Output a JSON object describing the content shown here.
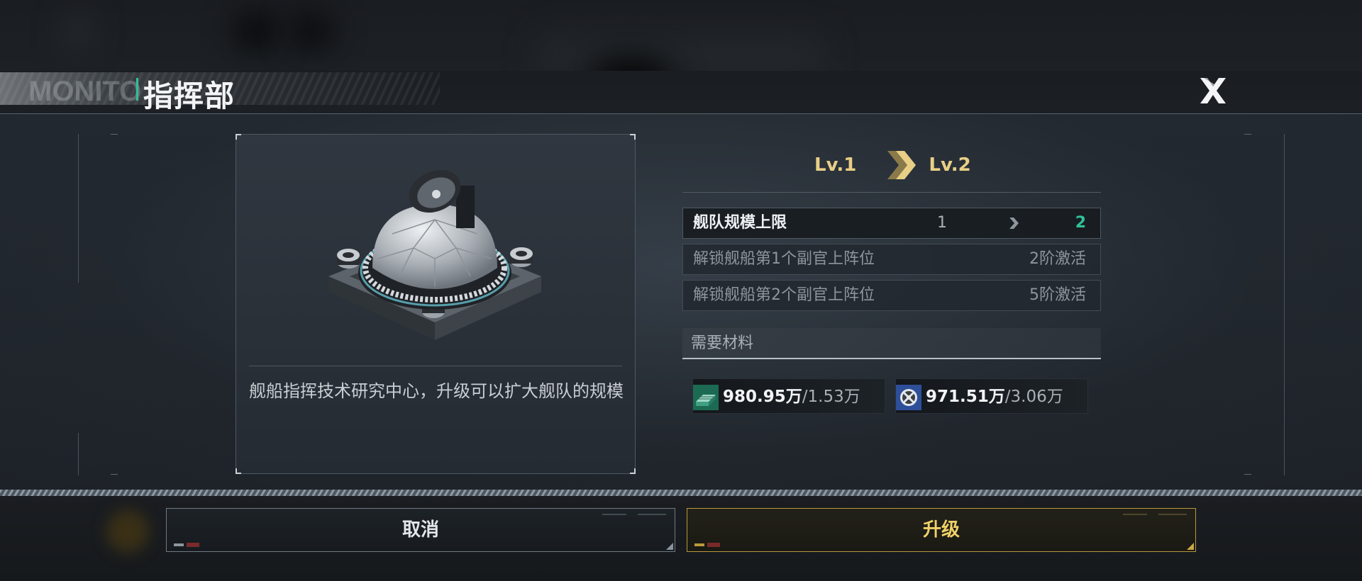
{
  "header": {
    "title": "指挥部",
    "close_icon": "close-x-icon"
  },
  "building": {
    "icon": "command-center-dome-icon",
    "description": "舰船指挥技术研究中心，升级可以扩大舰队的规模"
  },
  "levels": {
    "from": "Lv.1",
    "to": "Lv.2",
    "arrow_icon": "double-chevron-right-icon"
  },
  "stats": [
    {
      "label": "舰队规模上限",
      "from": "1",
      "to": "2"
    },
    {
      "label": "解锁舰船第1个副官上阵位",
      "value": "2阶激活"
    },
    {
      "label": "解锁舰船第2个副官上阵位",
      "value": "5阶激活"
    }
  ],
  "materials": {
    "header": "需要材料",
    "items": [
      {
        "icon": "alloy-bars-icon",
        "have": "980.95万",
        "need": "/1.53万"
      },
      {
        "icon": "gear-crystal-icon",
        "have": "971.51万",
        "need": "/3.06万"
      }
    ]
  },
  "buttons": {
    "cancel": "取消",
    "upgrade": "升级"
  },
  "colors": {
    "accent_green": "#2fc29a",
    "level_gold": "#e8cf86",
    "upgrade_gold": "#f0d168"
  }
}
